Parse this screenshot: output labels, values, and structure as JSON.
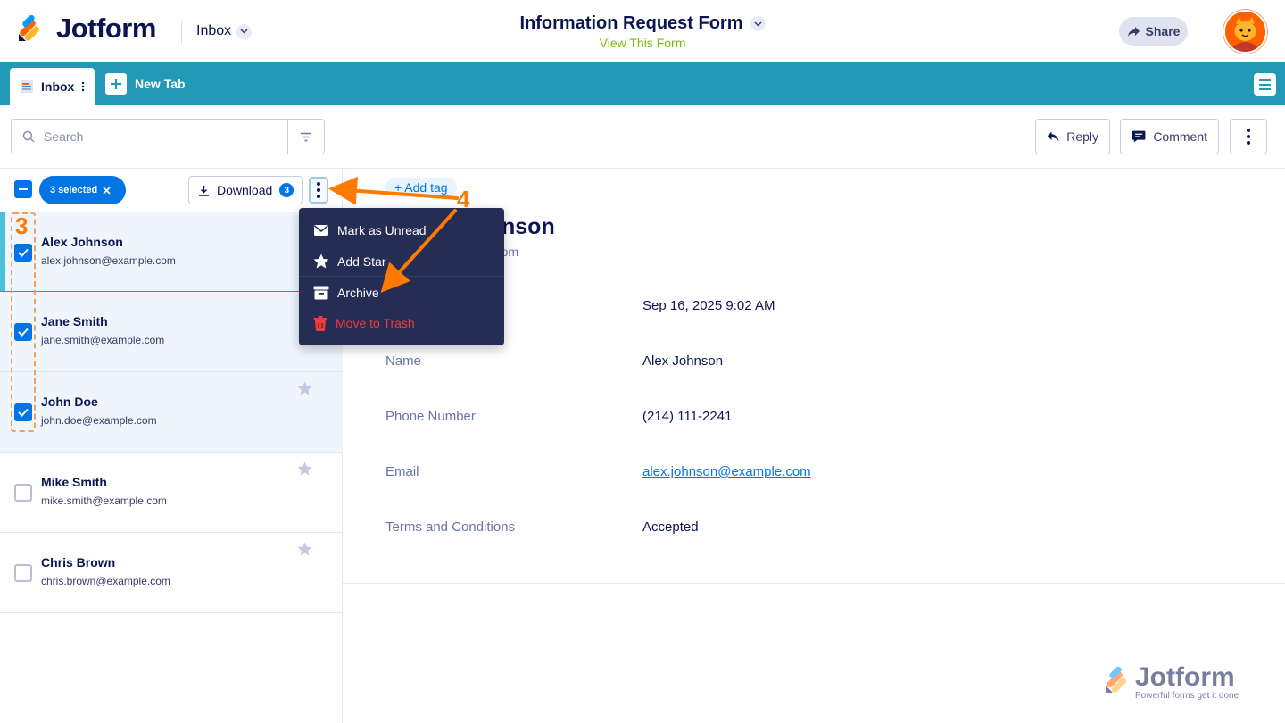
{
  "brand": {
    "name": "Jotform",
    "tagline": "Powerful forms get it done"
  },
  "header": {
    "inbox_label": "Inbox",
    "form_title": "Information Request Form",
    "view_form_link": "View This Form",
    "share_label": "Share"
  },
  "tabs": {
    "inbox_label": "Inbox",
    "new_tab_label": "New Tab"
  },
  "search": {
    "placeholder": "Search"
  },
  "actions": {
    "reply_label": "Reply",
    "comment_label": "Comment"
  },
  "list_toolbar": {
    "selected_label": "3 selected",
    "download_label": "Download",
    "download_count": "3"
  },
  "submissions": [
    {
      "name": "Alex Johnson",
      "email": "alex.johnson@example.com",
      "checked": true,
      "starred": false
    },
    {
      "name": "Jane Smith",
      "email": "jane.smith@example.com",
      "checked": true,
      "starred": false
    },
    {
      "name": "John Doe",
      "email": "john.doe@example.com",
      "checked": true,
      "starred": false
    },
    {
      "name": "Mike Smith",
      "email": "mike.smith@example.com",
      "checked": false,
      "starred": false
    },
    {
      "name": "Chris Brown",
      "email": "chris.brown@example.com",
      "checked": false,
      "starred": false
    }
  ],
  "menu": {
    "mark_unread": "Mark as Unread",
    "add_star": "Add Star",
    "archive": "Archive",
    "trash": "Move to Trash"
  },
  "detail": {
    "add_tag": "+ Add tag",
    "name_partial": "nson",
    "email_partial": "ple.com",
    "date_value": "Sep 16, 2025 9:02 AM",
    "fields": [
      {
        "label": "Name",
        "value": "Alex Johnson"
      },
      {
        "label": "Phone Number",
        "value": "(214) 111-2241"
      },
      {
        "label": "Email",
        "value": "alex.johnson@example.com"
      },
      {
        "label": "Terms and Conditions",
        "value": "Accepted"
      }
    ]
  },
  "annotations": {
    "step3": "3",
    "step4": "4"
  },
  "colors": {
    "accent": "#0075e3",
    "tabbar": "#229ab7",
    "menu_bg": "#262d55",
    "annotation": "#ff7a00",
    "danger": "#f23a3c"
  }
}
